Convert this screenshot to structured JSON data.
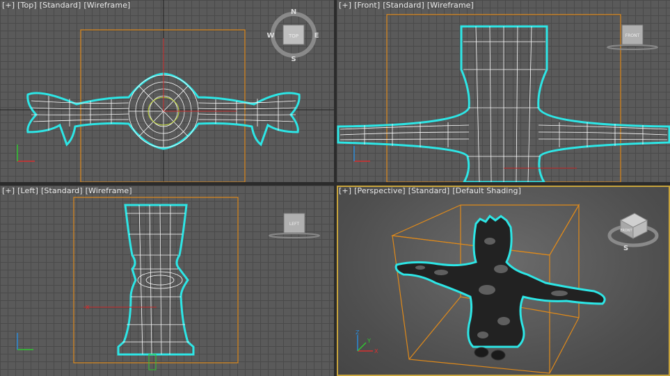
{
  "viewports": {
    "top": {
      "maximize": "[+]",
      "view": "[Top]",
      "mode": "[Standard]",
      "shading": "[Wireframe]",
      "cube_label": "TOP",
      "compass": {
        "n": "N",
        "s": "S",
        "e": "E",
        "w": "W"
      }
    },
    "front": {
      "maximize": "[+]",
      "view": "[Front]",
      "mode": "[Standard]",
      "shading": "[Wireframe]",
      "cube_label": "FRONT"
    },
    "left": {
      "maximize": "[+]",
      "view": "[Left]",
      "mode": "[Standard]",
      "shading": "[Wireframe]",
      "cube_label": "LEFT"
    },
    "perspective": {
      "maximize": "[+]",
      "view": "[Perspective]",
      "mode": "[Standard]",
      "shading": "[Default Shading]",
      "cube_label": "FRONT",
      "compass_s": "S"
    }
  },
  "axes": {
    "x": "X",
    "y": "Y",
    "z": "Z"
  },
  "colors": {
    "wire": "#ffffff",
    "selection": "#2de6e6",
    "bbox": "#e08a1a",
    "grid_bg": "#5a5a5a",
    "active_border": "#c8a43c"
  },
  "active_viewport": "perspective"
}
